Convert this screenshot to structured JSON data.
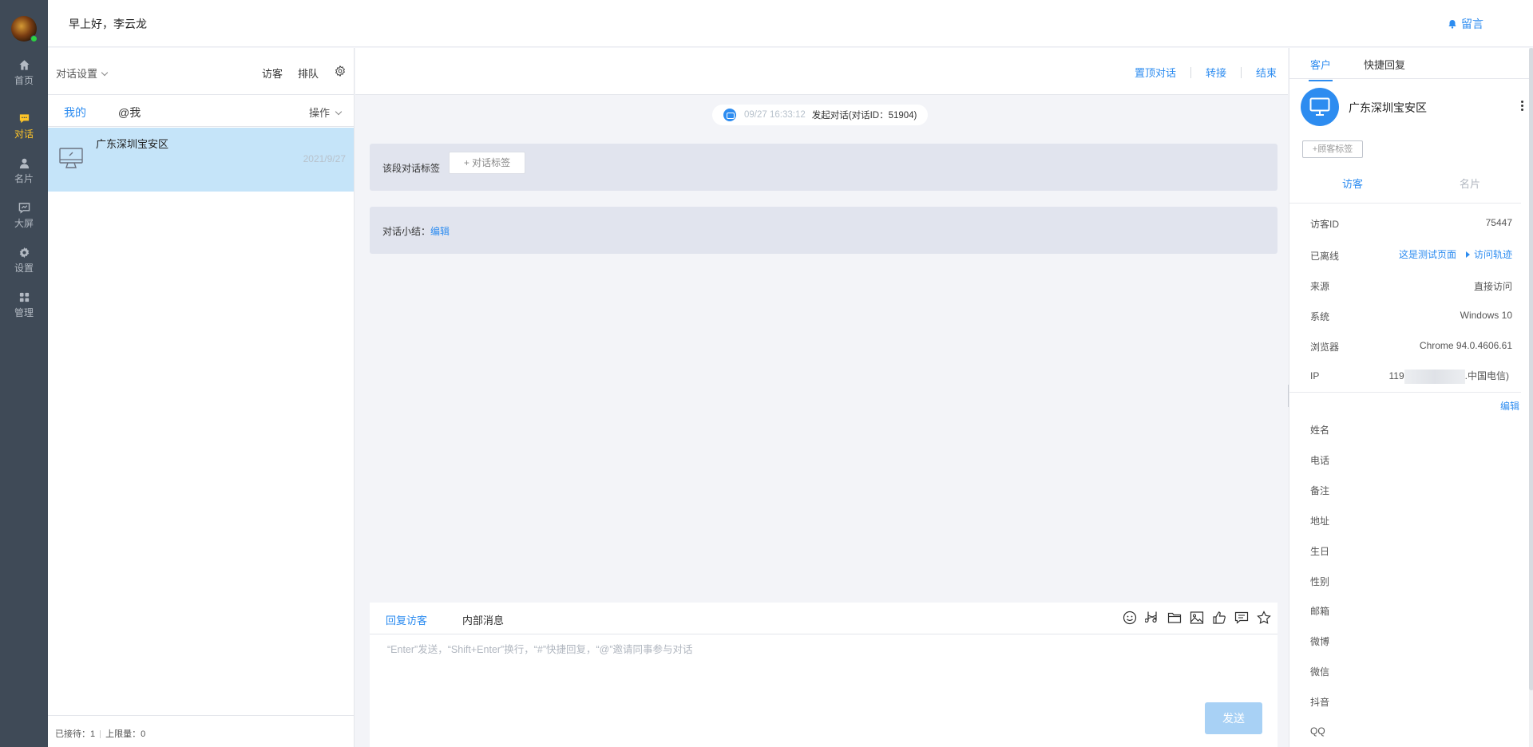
{
  "rail": {
    "items": [
      {
        "label": "首页",
        "icon": "home-icon"
      },
      {
        "label": "对话",
        "icon": "chat-icon"
      },
      {
        "label": "名片",
        "icon": "person-icon"
      },
      {
        "label": "大屏",
        "icon": "screen-icon"
      },
      {
        "label": "设置",
        "icon": "gear-icon"
      },
      {
        "label": "管理",
        "icon": "grid-icon"
      }
    ],
    "active_index": 1,
    "active_color": "#ffc527"
  },
  "topbar": {
    "greeting": "早上好，李云龙",
    "message_link": "留言"
  },
  "conv_list": {
    "settings_label": "对话设置",
    "visitor_label": "访客",
    "queue_label": "排队",
    "tabs": [
      "我的",
      "@我"
    ],
    "ops_label": "操作",
    "items": [
      {
        "name": "广东深圳宝安区",
        "date": "2021/9/27"
      }
    ],
    "footer": {
      "served": "已接待：1",
      "limit": "上限量：0"
    }
  },
  "chat": {
    "actions": [
      "置顶对话",
      "转接",
      "结束"
    ],
    "system_message": {
      "time": "09/27 16:33:12",
      "text": "发起对话(对话ID：51904)"
    },
    "tag_panel": {
      "label": "该段对话标签",
      "button": "+ 对话标签"
    },
    "summary": {
      "label": "对话小结：",
      "edit": "编辑"
    },
    "reply_tabs": [
      "回复访客",
      "内部消息"
    ],
    "tools": [
      "emoji-icon",
      "scissors-icon",
      "folder-icon",
      "image-icon",
      "thumbs-up-icon",
      "comment-icon",
      "star-icon"
    ],
    "input_placeholder": "“Enter”发送，“Shift+Enter”换行，“#”快捷回复，“@”邀请同事参与对话",
    "send_label": "发送"
  },
  "customer": {
    "tabs": [
      "客户",
      "快捷回复"
    ],
    "name": "广东深圳宝安区",
    "tag_button": "+顾客标签",
    "sub_tabs": [
      "访客",
      "名片"
    ],
    "info": [
      {
        "key": "访客ID",
        "value": "75447"
      },
      {
        "key": "已离线",
        "page": "这是测试页面",
        "trail": "访问轨迹"
      },
      {
        "key": "来源",
        "value": "直接访问"
      },
      {
        "key": "系统",
        "value": "Windows 10"
      },
      {
        "key": "浏览器",
        "value": "Chrome 94.0.4606.61"
      },
      {
        "key": "IP",
        "value_prefix": "119",
        "value_suffix": ".中国电信)"
      }
    ],
    "edit_label": "编辑",
    "fields": [
      "姓名",
      "电话",
      "备注",
      "地址",
      "生日",
      "性别",
      "邮箱",
      "微博",
      "微信",
      "抖音",
      "QQ"
    ]
  },
  "colors": {
    "accent": "#2d8cf0",
    "rail_bg": "#3f4a57",
    "selected_row": "#c5e4f9",
    "send_disabled": "#a8d1f5"
  }
}
